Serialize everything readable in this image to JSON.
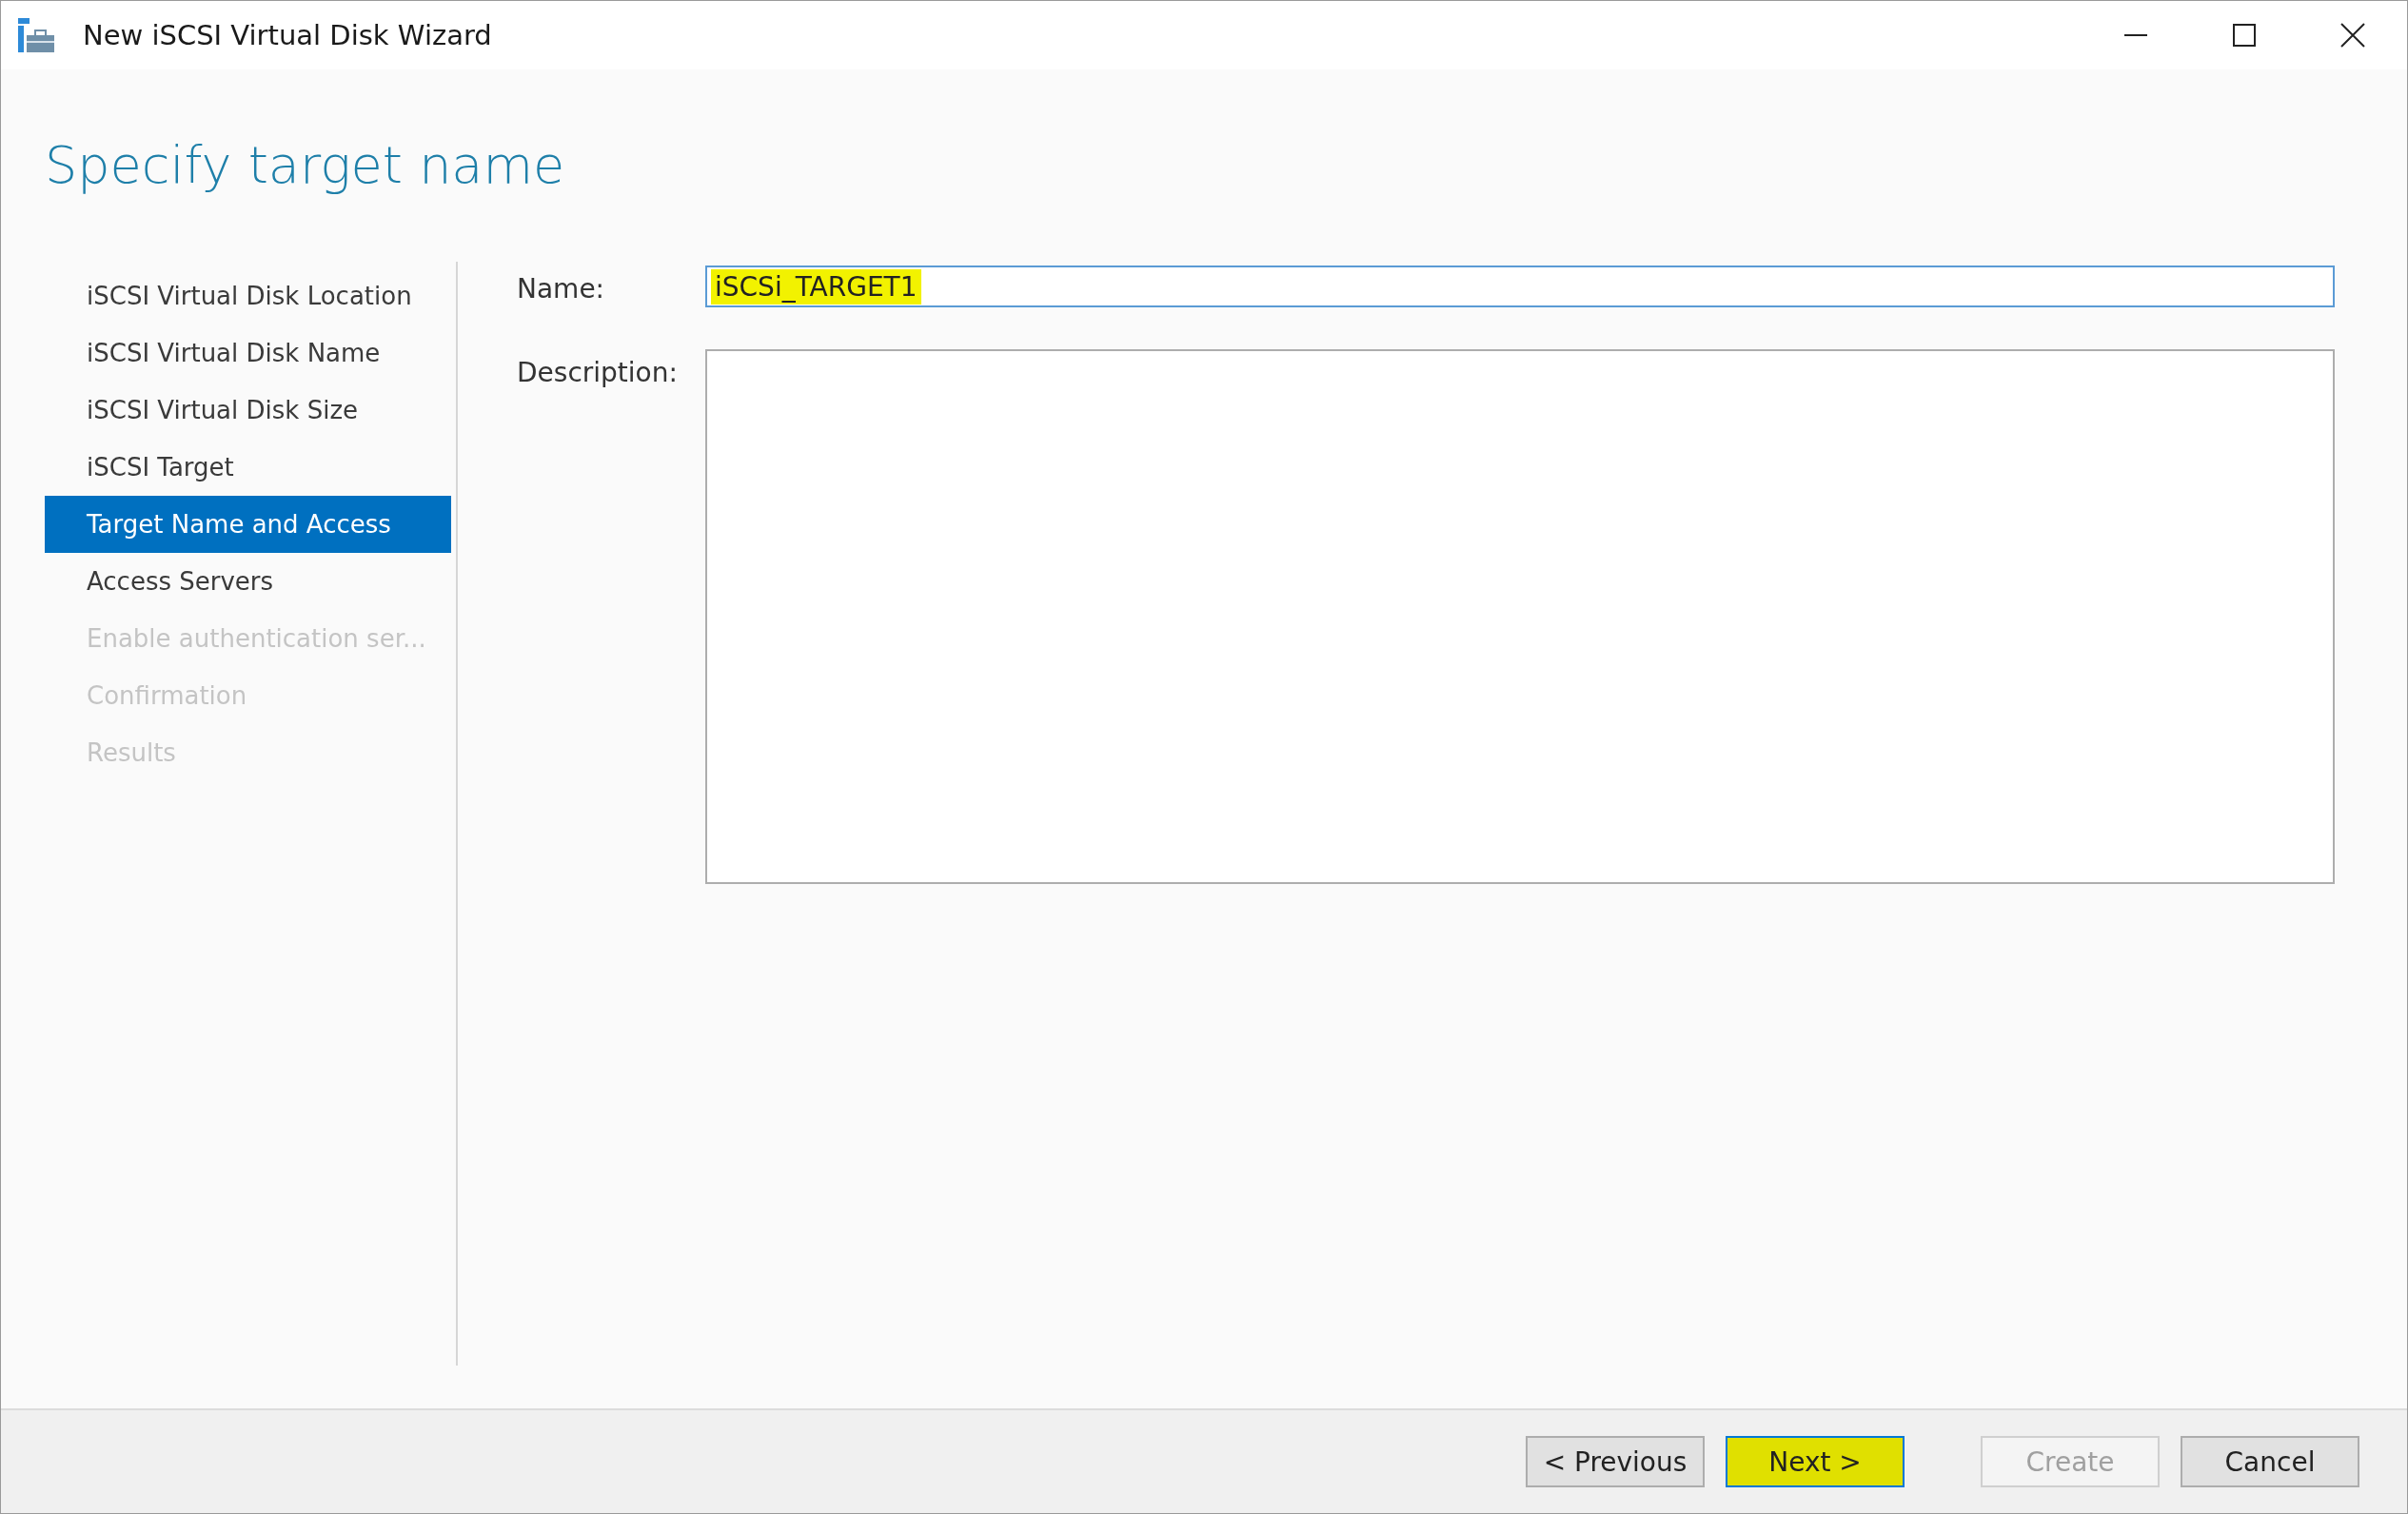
{
  "window": {
    "title": "New iSCSI Virtual Disk Wizard"
  },
  "heading": "Specify target name",
  "sidebar": {
    "items": [
      {
        "label": "iSCSI Virtual Disk Location",
        "selected": false,
        "disabled": false
      },
      {
        "label": "iSCSI Virtual Disk Name",
        "selected": false,
        "disabled": false
      },
      {
        "label": "iSCSI Virtual Disk Size",
        "selected": false,
        "disabled": false
      },
      {
        "label": "iSCSI Target",
        "selected": false,
        "disabled": false
      },
      {
        "label": "Target Name and Access",
        "selected": true,
        "disabled": false
      },
      {
        "label": "Access Servers",
        "selected": false,
        "disabled": false
      },
      {
        "label": "Enable authentication ser...",
        "selected": false,
        "disabled": true
      },
      {
        "label": "Confirmation",
        "selected": false,
        "disabled": true
      },
      {
        "label": "Results",
        "selected": false,
        "disabled": true
      }
    ]
  },
  "form": {
    "name": {
      "label": "Name:",
      "value": "iSCSi_TARGET1",
      "highlighted": true
    },
    "description": {
      "label": "Description:"
    }
  },
  "buttons": [
    {
      "label": "< Previous",
      "disabled": false,
      "focused": false,
      "highlighted": false
    },
    {
      "label": "Next >",
      "disabled": false,
      "focused": true,
      "highlighted": true
    },
    {
      "label": "Create",
      "disabled": true,
      "focused": false,
      "highlighted": false
    },
    {
      "label": "Cancel",
      "disabled": false,
      "focused": false,
      "highlighted": false
    }
  ]
}
